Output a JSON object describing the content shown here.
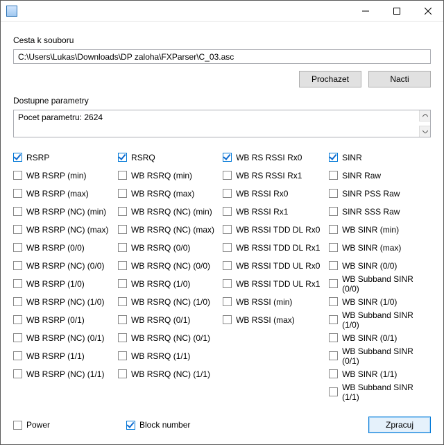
{
  "window": {
    "title": ""
  },
  "labels": {
    "file_path": "Cesta k souboru",
    "available_params": "Dostupne parametry"
  },
  "inputs": {
    "file_path_value": "C:\\Users\\Lukas\\Downloads\\DP zaloha\\FXParser\\C_03.asc",
    "param_count": "Pocet parametru: 2624"
  },
  "buttons": {
    "browse": "Prochazet",
    "load": "Nacti",
    "process": "Zpracuj"
  },
  "columns": [
    [
      {
        "label": "RSRP",
        "checked": true
      },
      {
        "label": "WB RSRP (min)",
        "checked": false
      },
      {
        "label": "WB RSRP (max)",
        "checked": false
      },
      {
        "label": "WB RSRP (NC) (min)",
        "checked": false
      },
      {
        "label": "WB RSRP (NC) (max)",
        "checked": false
      },
      {
        "label": "WB RSRP (0/0)",
        "checked": false
      },
      {
        "label": "WB RSRP (NC) (0/0)",
        "checked": false
      },
      {
        "label": "WB RSRP (1/0)",
        "checked": false
      },
      {
        "label": "WB RSRP (NC) (1/0)",
        "checked": false
      },
      {
        "label": "WB RSRP (0/1)",
        "checked": false
      },
      {
        "label": "WB RSRP (NC) (0/1)",
        "checked": false
      },
      {
        "label": "WB RSRP (1/1)",
        "checked": false
      },
      {
        "label": "WB RSRP (NC) (1/1)",
        "checked": false
      }
    ],
    [
      {
        "label": "RSRQ",
        "checked": true
      },
      {
        "label": "WB RSRQ (min)",
        "checked": false
      },
      {
        "label": "WB RSRQ (max)",
        "checked": false
      },
      {
        "label": "WB RSRQ (NC) (min)",
        "checked": false
      },
      {
        "label": "WB RSRQ (NC) (max)",
        "checked": false
      },
      {
        "label": "WB RSRQ (0/0)",
        "checked": false
      },
      {
        "label": "WB RSRQ (NC) (0/0)",
        "checked": false
      },
      {
        "label": "WB RSRQ (1/0)",
        "checked": false
      },
      {
        "label": "WB RSRQ (NC) (1/0)",
        "checked": false
      },
      {
        "label": "WB RSRQ (0/1)",
        "checked": false
      },
      {
        "label": "WB RSRQ (NC) (0/1)",
        "checked": false
      },
      {
        "label": "WB RSRQ (1/1)",
        "checked": false
      },
      {
        "label": "WB RSRQ (NC) (1/1)",
        "checked": false
      }
    ],
    [
      {
        "label": "WB RS RSSI Rx0",
        "checked": true
      },
      {
        "label": "WB RS RSSI Rx1",
        "checked": false
      },
      {
        "label": "WB RSSI Rx0",
        "checked": false
      },
      {
        "label": "WB RSSI Rx1",
        "checked": false
      },
      {
        "label": "WB RSSI TDD DL Rx0",
        "checked": false
      },
      {
        "label": "WB RSSI TDD DL Rx1",
        "checked": false
      },
      {
        "label": "WB RSSI TDD UL Rx0",
        "checked": false
      },
      {
        "label": "WB RSSI TDD UL Rx1",
        "checked": false
      },
      {
        "label": "WB RSSI (min)",
        "checked": false
      },
      {
        "label": "WB RSSI (max)",
        "checked": false
      }
    ],
    [
      {
        "label": "SINR",
        "checked": true
      },
      {
        "label": "SINR Raw",
        "checked": false
      },
      {
        "label": "SINR PSS Raw",
        "checked": false
      },
      {
        "label": "SINR SSS Raw",
        "checked": false
      },
      {
        "label": "WB SINR (min)",
        "checked": false
      },
      {
        "label": "WB SINR (max)",
        "checked": false
      },
      {
        "label": "WB SINR (0/0)",
        "checked": false
      },
      {
        "label": "WB Subband SINR (0/0)",
        "checked": false
      },
      {
        "label": "WB SINR (1/0)",
        "checked": false
      },
      {
        "label": "WB Subband SINR (1/0)",
        "checked": false
      },
      {
        "label": "WB SINR (0/1)",
        "checked": false
      },
      {
        "label": "WB Subband SINR (0/1)",
        "checked": false
      },
      {
        "label": "WB SINR (1/1)",
        "checked": false
      },
      {
        "label": "WB Subband SINR (1/1)",
        "checked": false
      }
    ]
  ],
  "bottom_checks": {
    "power": {
      "label": "Power",
      "checked": false
    },
    "block_number": {
      "label": "Block number",
      "checked": true
    }
  }
}
